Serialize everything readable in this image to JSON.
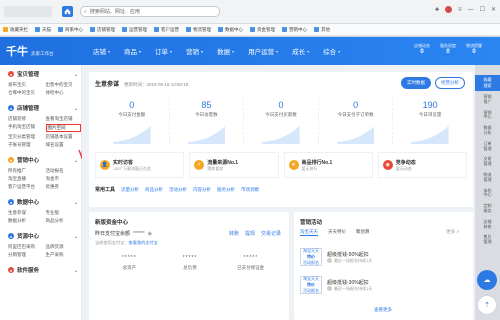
{
  "browser": {
    "address": "搜索网站、网址、应用",
    "notif_count": "1",
    "bookmarks": [
      "收藏夹栏",
      "天猫",
      "商家中心",
      "店铺管理",
      "运营管理",
      "客户运营",
      "物流管理",
      "数据中心",
      "资金管理",
      "营销中心",
      "其他"
    ]
  },
  "header": {
    "logo": "千牛",
    "logo_sub": "卖家工作台",
    "nav": [
      "店铺",
      "商品",
      "订单",
      "营销",
      "数据",
      "用户运营",
      "成长",
      "综合"
    ],
    "stats": [
      {
        "label": "店铺动态",
        "value": "0"
      },
      {
        "label": "服务进度",
        "value": "0"
      },
      {
        "label": "物流提醒",
        "value": "0"
      }
    ]
  },
  "sidebar": [
    {
      "title": "宝贝管理",
      "icon_color": "#e8493b",
      "links": [
        "发布宝贝",
        "出售中的宝贝",
        "仓库中的宝贝",
        "体检中心"
      ]
    },
    {
      "title": "店铺管理",
      "icon_color": "#2d7ae5",
      "links": [
        "店铺装修",
        "查看淘宝店铺",
        "手机淘宝店铺",
        "图片空间",
        "宝贝分类管理",
        "店铺基本设置",
        "子账号管理",
        "域名设置"
      ]
    },
    {
      "title": "营销中心",
      "icon_color": "#f5a623",
      "links": [
        "所有推广",
        "活动报名",
        "淘宝直播",
        "淘金币",
        "客户运营平台",
        "优惠券"
      ]
    },
    {
      "title": "数据中心",
      "icon_color": "#2d7ae5",
      "links": [
        "生意参谋",
        "专业版",
        "数据分析",
        "商品分析"
      ]
    },
    {
      "title": "货源中心",
      "icon_color": "#2d7ae5",
      "links": [
        "阿里巴巴采购",
        "品牌货源",
        "分销管理",
        "生产采购"
      ]
    },
    {
      "title": "软件服务",
      "icon_color": "#e8493b",
      "links": []
    }
  ],
  "highlighted_link": "图片空间",
  "business": {
    "title": "生意参谋",
    "updated": "更新时间：2019-05-18 13:50:18",
    "tabs": [
      "实时数据",
      "经营分析"
    ],
    "kpis": [
      {
        "value": "0",
        "label": "今日支付金额"
      },
      {
        "value": "85",
        "label": "今日访客数"
      },
      {
        "value": "0",
        "label": "今日支付买家数"
      },
      {
        "value": "0",
        "label": "今日支付子订单数"
      },
      {
        "value": "190",
        "label": "今日浏览量"
      }
    ],
    "notices": [
      {
        "title": "实时访客",
        "desc": "1307 万客流量正在此",
        "color": "#f5a623",
        "glyph": "👤"
      },
      {
        "title": "流量来源No.1",
        "desc": "猜你喜欢",
        "color": "#f5a623",
        "glyph": "⚡"
      },
      {
        "title": "商品排行No.1",
        "desc": "暂无排行",
        "color": "#f5a623",
        "glyph": "★"
      },
      {
        "title": "竞争动态",
        "desc": "暂无动态",
        "color": "#e8493b",
        "glyph": "◉"
      }
    ],
    "tools_title": "常用工具",
    "tools": [
      "流量分析",
      "商品分析",
      "活动分析",
      "内容分析",
      "服务分析",
      "市场洞察"
    ]
  },
  "funds": {
    "title": "新版资金中心",
    "yesterday_label": "昨日支付宝余额",
    "yesterday_value": "******",
    "actions": [
      "转账",
      "提现",
      "交易记录"
    ],
    "sub_prefix": "当前使用支付宝：",
    "sub_link": "查看我的支付宝",
    "stats": [
      {
        "value": "*****",
        "label": "总资产"
      },
      {
        "value": "*****",
        "label": "总负债"
      },
      {
        "value": "*****",
        "label": "已支付保证金"
      }
    ]
  },
  "marketing": {
    "title": "营销活动",
    "tabs": [
      "淘宝天天",
      "天天特价",
      "聚划算"
    ],
    "more": "更多 >",
    "promos": [
      {
        "badge_top": "淘宝天天",
        "badge_mid": "特价",
        "badge_bot": "活动报名",
        "title": "超级抵钱-50%起扣",
        "meta": "最近一场报名持续1天"
      },
      {
        "badge_top": "淘宝天天",
        "badge_mid": "特价",
        "badge_bot": "活动报名",
        "title": "超级抵钱-30%起扣",
        "meta": "最近一场报名持续1天"
      }
    ],
    "check_more": "查看更多"
  },
  "right_bar": {
    "top": "收藏\n搜索",
    "items": [
      "营销\n推广",
      "营销\n中心",
      "数据\n分析",
      "订单\n管理",
      "交易\n管理",
      "物流\n管理",
      "体检\n中心",
      "定制\n服务",
      "店铺\n装修",
      "售后\n管理"
    ]
  }
}
